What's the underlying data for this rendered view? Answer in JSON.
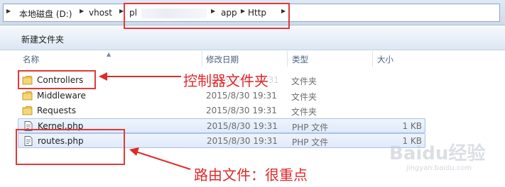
{
  "breadcrumb": {
    "items": [
      "本地磁盘 (D:)",
      "vhost",
      "pl",
      "app",
      "Http"
    ]
  },
  "toolbar": {
    "new_folder_label": "新建文件夹"
  },
  "columns": {
    "name": "名称",
    "date": "修改日期",
    "type": "类型",
    "size": "大小"
  },
  "files": [
    {
      "name": "Controllers",
      "date": "2015/8/30 19:31",
      "type": "文件夹",
      "size": "",
      "kind": "folder"
    },
    {
      "name": "Middleware",
      "date": "2015/8/30 19:31",
      "type": "文件夹",
      "size": "",
      "kind": "folder"
    },
    {
      "name": "Requests",
      "date": "2015/8/30 19:31",
      "type": "文件夹",
      "size": "",
      "kind": "folder"
    },
    {
      "name": "Kernel.php",
      "date": "2015/8/30 19:31",
      "type": "PHP 文件",
      "size": "1 KB",
      "kind": "php"
    },
    {
      "name": "routes.php",
      "date": "2015/8/30 19:31",
      "type": "PHP 文件",
      "size": "1 KB",
      "kind": "php"
    }
  ],
  "annotations": {
    "controllers_note": "控制器文件夹",
    "routes_note": "路由文件：很重点"
  },
  "watermark": {
    "logo": "Baidu经验",
    "url": "jingyan.baidu.com"
  },
  "colors": {
    "annotation_red": "#e02a2a",
    "selection_blue": "#dfeaf9",
    "folder_yellow": "#e9bf4c"
  }
}
